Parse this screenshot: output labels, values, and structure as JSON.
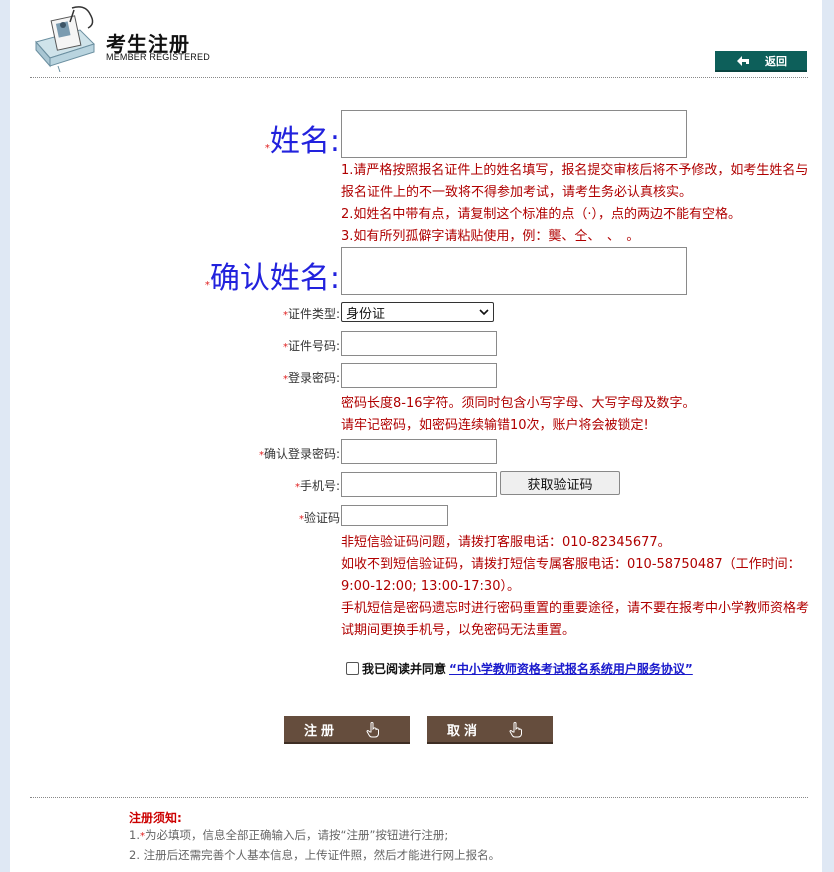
{
  "header": {
    "title_cn": "考生注册",
    "title_en": "MEMBER REGISTERED",
    "back_label": "返回"
  },
  "form": {
    "name_label": "姓名:",
    "name_notes": [
      "1.请严格按照报名证件上的姓名填写，报名提交审核后将不予修改，如考生姓名与报名证件上的不一致将不得参加考试，请考生务必认真核实。",
      "2.如姓名中带有点，请复制这个标准的点（·），点的两边不能有空格。",
      "3.如有所列孤僻字请粘贴使用，例：龑、仝、　、　。"
    ],
    "confirm_name_label": "确认姓名:",
    "id_type_label": "证件类型:",
    "id_type_value": "身份证",
    "id_number_label": "证件号码:",
    "password_label": "登录密码:",
    "password_notes": [
      "密码长度8-16字符。须同时包含小写字母、大写字母及数字。",
      "请牢记密码，如密码连续输错10次，账户将会被锁定!"
    ],
    "confirm_password_label": "确认登录密码:",
    "phone_label": "手机号:",
    "get_code_label": "获取验证码",
    "code_label": "验证码",
    "code_notes": [
      "非短信验证码问题，请拨打客服电话：010-82345677。",
      "如收不到短信验证码，请拨打短信专属客服电话：010-58750487（工作时间：9:00-12:00; 13:00-17:30）。",
      "手机短信是密码遗忘时进行密码重置的重要途径，请不要在报考中小学教师资格考试期间更换手机号，以免密码无法重置。"
    ],
    "agree_text": "我已阅读并同意",
    "agree_link": "“中小学教师资格考试报名系统用户服务协议”",
    "required_mark": "*"
  },
  "actions": {
    "register_label": "注册",
    "cancel_label": "取消"
  },
  "footer": {
    "title": "注册须知:",
    "line1_prefix": "1.",
    "line1_mark": "*",
    "line1_text": "为必填项，信息全部正确输入后，请按“注册”按钮进行注册;",
    "line2": "2. 注册后还需完善个人基本信息，上传证件照，然后才能进行网上报名。"
  },
  "colors": {
    "accent_blue": "#2222dd",
    "note_red": "#b00000",
    "button_brown": "#654d3d",
    "back_teal": "#0d5f5a"
  },
  "icons": [
    "id-card-logo-icon",
    "back-arrow-icon",
    "hand-pointer-icon",
    "dropdown-chevron-icon"
  ]
}
